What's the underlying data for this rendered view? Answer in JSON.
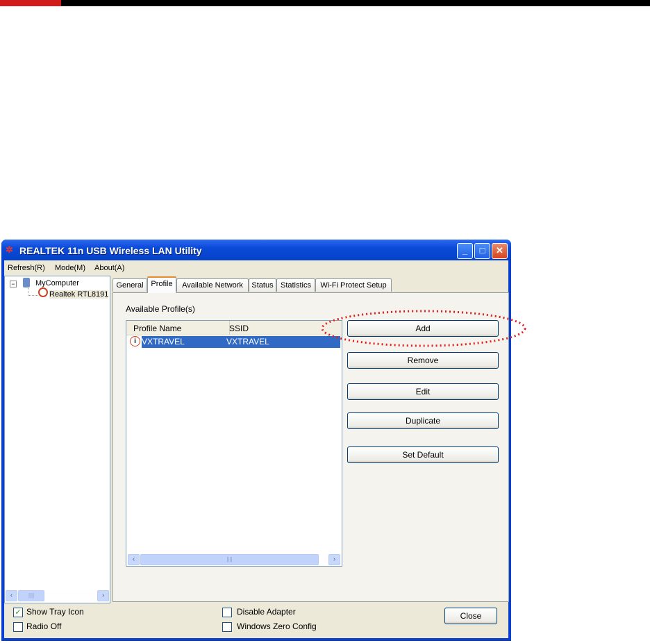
{
  "window": {
    "title": "REALTEK 11n USB Wireless LAN Utility",
    "minimize": "_",
    "maximize": "□",
    "close": "✕"
  },
  "menu": [
    "Refresh(R)",
    "Mode(M)",
    "About(A)"
  ],
  "tree": {
    "root": "MyComputer",
    "child": "Realtek RTL8191"
  },
  "tabs": [
    "General",
    "Profile",
    "Available Network",
    "Status",
    "Statistics",
    "Wi-Fi Protect Setup"
  ],
  "active_tab": "Profile",
  "profile": {
    "section_label": "Available Profile(s)",
    "columns": [
      "Profile Name",
      "SSID"
    ],
    "rows": [
      {
        "name": "VXTRAVEL",
        "ssid": "VXTRAVEL"
      }
    ],
    "buttons": [
      "Add",
      "Remove",
      "Edit",
      "Duplicate",
      "Set Default"
    ]
  },
  "bottom": {
    "show_tray_icon": "Show Tray Icon",
    "show_tray_checked": true,
    "radio_off": "Radio Off",
    "disable_adapter": "Disable Adapter",
    "windows_zero_config": "Windows Zero Config",
    "close": "Close",
    "check": "✓"
  },
  "scroll": {
    "left": "‹",
    "right": "›",
    "grip": "||||"
  },
  "colors": {
    "selection": "#316ac5",
    "highlight_ellipse": "#e02020"
  }
}
